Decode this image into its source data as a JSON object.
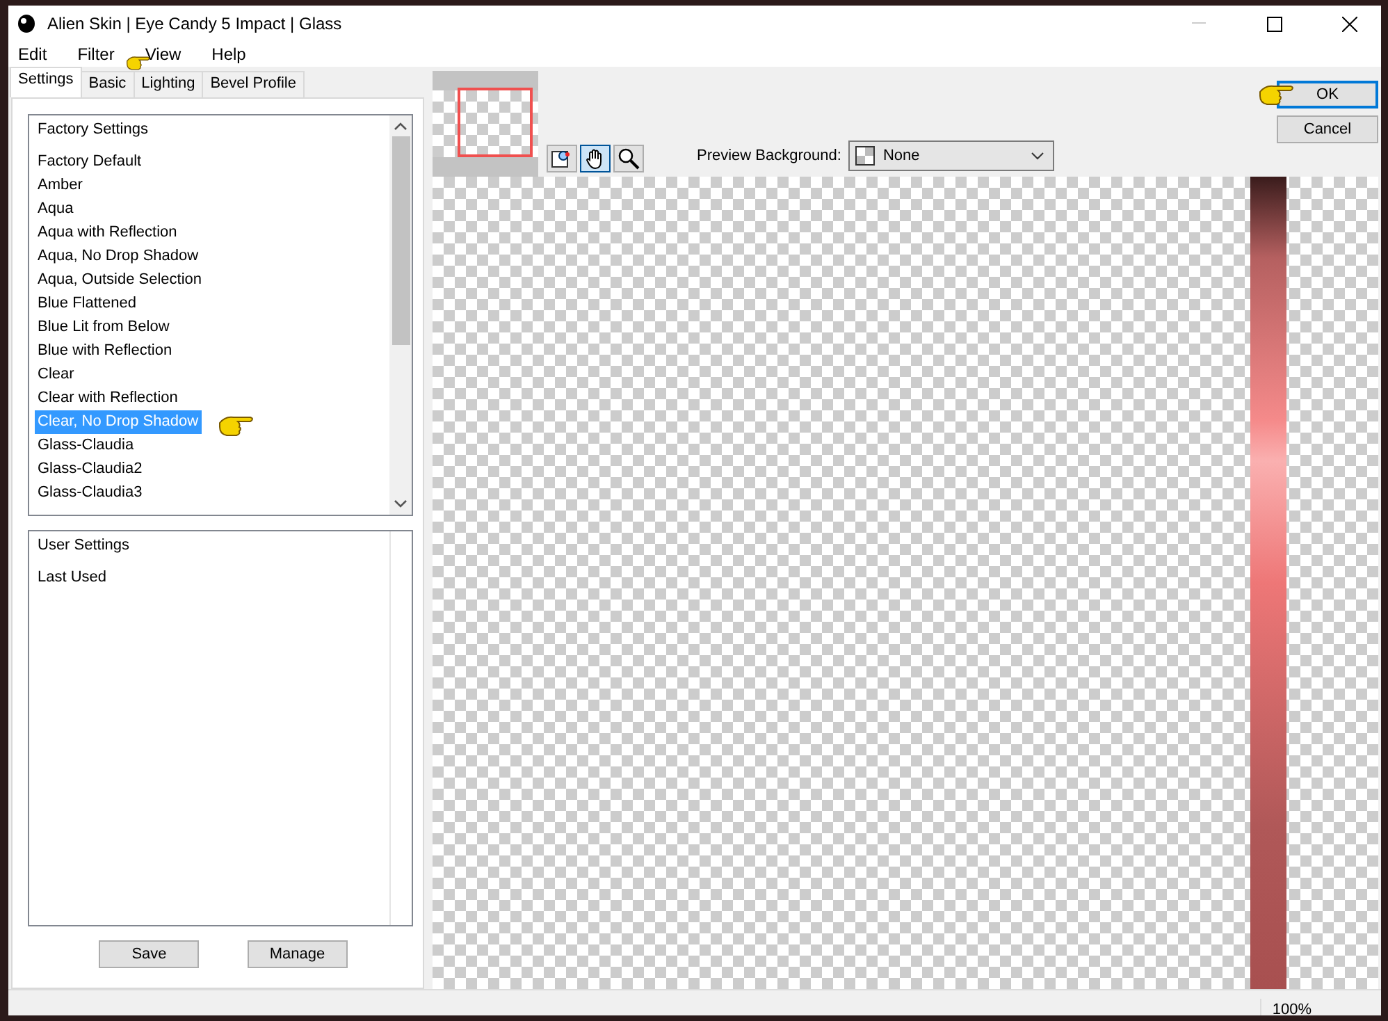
{
  "window": {
    "title": "Alien Skin | Eye Candy 5 Impact | Glass"
  },
  "menu": [
    "Edit",
    "Filter",
    "View",
    "Help"
  ],
  "tabs": [
    {
      "label": "Settings",
      "selected": true
    },
    {
      "label": "Basic",
      "selected": false
    },
    {
      "label": "Lighting",
      "selected": false
    },
    {
      "label": "Bevel Profile",
      "selected": false
    }
  ],
  "factory_list": {
    "header": "Factory Settings",
    "items": [
      {
        "label": "Factory Default",
        "selected": false
      },
      {
        "label": "Amber",
        "selected": false
      },
      {
        "label": "Aqua",
        "selected": false
      },
      {
        "label": "Aqua with Reflection",
        "selected": false
      },
      {
        "label": "Aqua, No Drop Shadow",
        "selected": false
      },
      {
        "label": "Aqua, Outside Selection",
        "selected": false
      },
      {
        "label": "Blue Flattened",
        "selected": false
      },
      {
        "label": "Blue Lit from Below",
        "selected": false
      },
      {
        "label": "Blue with Reflection",
        "selected": false
      },
      {
        "label": "Clear",
        "selected": false
      },
      {
        "label": "Clear with Reflection",
        "selected": false
      },
      {
        "label": "Clear, No Drop Shadow",
        "selected": true
      },
      {
        "label": "Glass-Claudia",
        "selected": false
      },
      {
        "label": "Glass-Claudia2",
        "selected": false
      },
      {
        "label": "Glass-Claudia3",
        "selected": false
      }
    ]
  },
  "user_list": {
    "header": "User Settings",
    "items": [
      {
        "label": "Last Used",
        "selected": false
      }
    ]
  },
  "list_buttons": [
    "Save",
    "Manage"
  ],
  "preview_tools": [
    {
      "kind": "navigator",
      "selected": false
    },
    {
      "kind": "hand",
      "selected": true
    },
    {
      "kind": "zoom",
      "selected": false
    }
  ],
  "preview_background": {
    "label": "Preview Background:",
    "value": "None"
  },
  "buttons": [
    {
      "label": "OK",
      "default": true
    },
    {
      "label": "Cancel",
      "default": false
    }
  ],
  "status_bar": {
    "zoom": "100%"
  }
}
